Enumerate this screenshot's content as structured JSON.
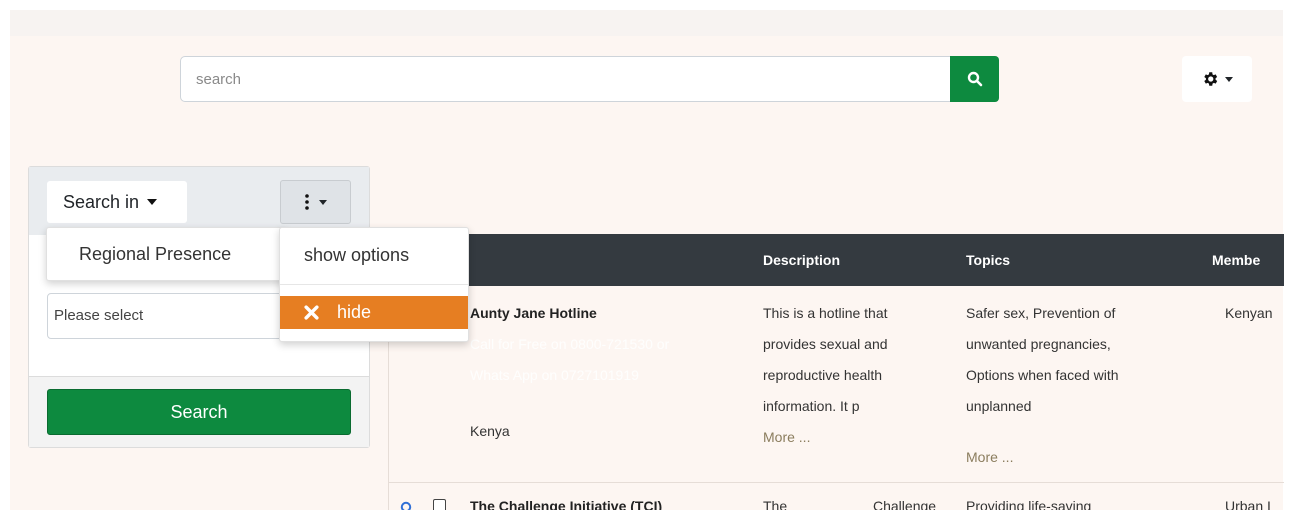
{
  "header": {
    "search_placeholder": "search",
    "search_icon": "search-icon",
    "settings_icon": "gear-icon"
  },
  "sidebar": {
    "search_in_label": "Search in",
    "select_placeholder": "Please select",
    "search_button": "Search"
  },
  "dropdown_search_in": {
    "item": "Regional Presence"
  },
  "dropdown_options": {
    "show_options": "show options",
    "hide": "hide"
  },
  "table": {
    "columns": [
      "Description",
      "Topics",
      "Membe"
    ],
    "rows": [
      {
        "name": "Aunty Jane Hotline",
        "contact_line1": "Call for Free on 0800-721530 or",
        "contact_line2": "Whats App on 0727101919",
        "country": "Kenya",
        "description_lines": [
          "This is a hotline that",
          "provides sexual and",
          "reproductive health",
          "information. It p"
        ],
        "description_more": "More ...",
        "topics_lines": [
          "Safer sex, Prevention of",
          "unwanted pregnancies,",
          "Options when faced with",
          "unplanned"
        ],
        "topics_more": "More ...",
        "member": "Kenyan"
      },
      {
        "name": "The Challenge Initiative (TCI)",
        "description_start": "The",
        "description_end": "Challenge",
        "topics_start": "Providing life-saving",
        "member": "Urban I"
      }
    ]
  },
  "colors": {
    "green": "#0d8a3f",
    "orange": "#e67e22",
    "dark_header": "#343a40",
    "page_bg": "#fdf6f2"
  }
}
